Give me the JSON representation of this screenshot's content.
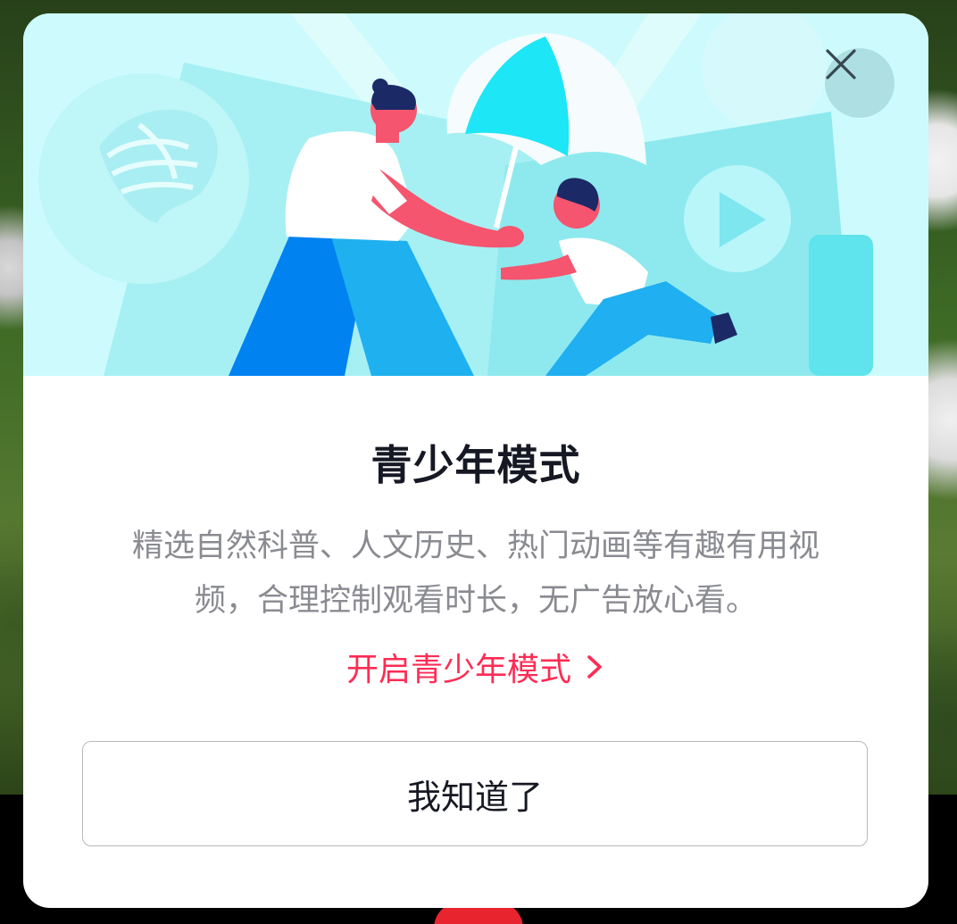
{
  "modal": {
    "title": "青少年模式",
    "description_line1": "精选自然科普、人文历史、热门动画等有趣有用视",
    "description_line2": "频，合理控制观看时长，无广告放心看。",
    "open_link_label": "开启青少年模式",
    "ack_button_label": "我知道了",
    "close_icon": "close-icon",
    "chevron_icon": "chevron-right-icon",
    "hero_illustration": "parent-holding-umbrella-over-child-illustration"
  },
  "colors": {
    "accent": "#fe2c55",
    "title": "#161823",
    "description": "#8a8b91",
    "hero_background": "#cdfbfd",
    "modal_background": "#ffffff"
  }
}
